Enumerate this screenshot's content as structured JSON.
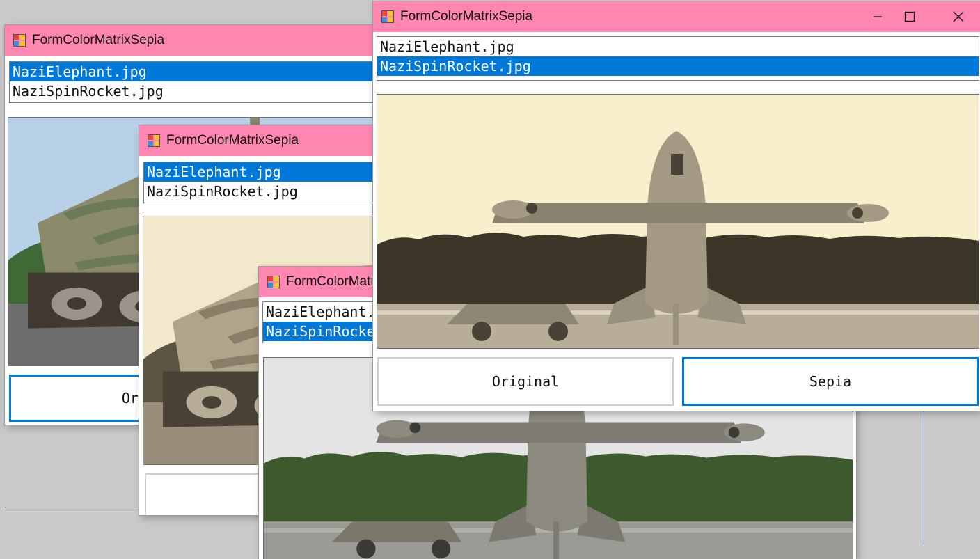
{
  "app": {
    "title": "FormColorMatrixSepia"
  },
  "list_items": [
    "NaziElephant.jpg",
    "NaziSpinRocket.jpg"
  ],
  "buttons": {
    "original": "Original",
    "sepia": "Sepia"
  },
  "windows": [
    {
      "id": "win1",
      "selected_item": "NaziElephant.jpg",
      "image": "tank",
      "filter": "original"
    },
    {
      "id": "win2",
      "selected_item": "NaziElephant.jpg",
      "image": "tank",
      "filter": "sepia"
    },
    {
      "id": "win3",
      "selected_item": "NaziSpinRocket.jpg",
      "image": "rocket",
      "filter": "original"
    },
    {
      "id": "win4",
      "selected_item": "NaziSpinRocket.jpg",
      "image": "rocket",
      "filter": "sepia",
      "active": true
    }
  ],
  "colors": {
    "titlebar": "#ff86b0",
    "selection": "#0078d7",
    "sepia_sky": "#f8f0cc",
    "desktop": "#c9c9c9"
  }
}
